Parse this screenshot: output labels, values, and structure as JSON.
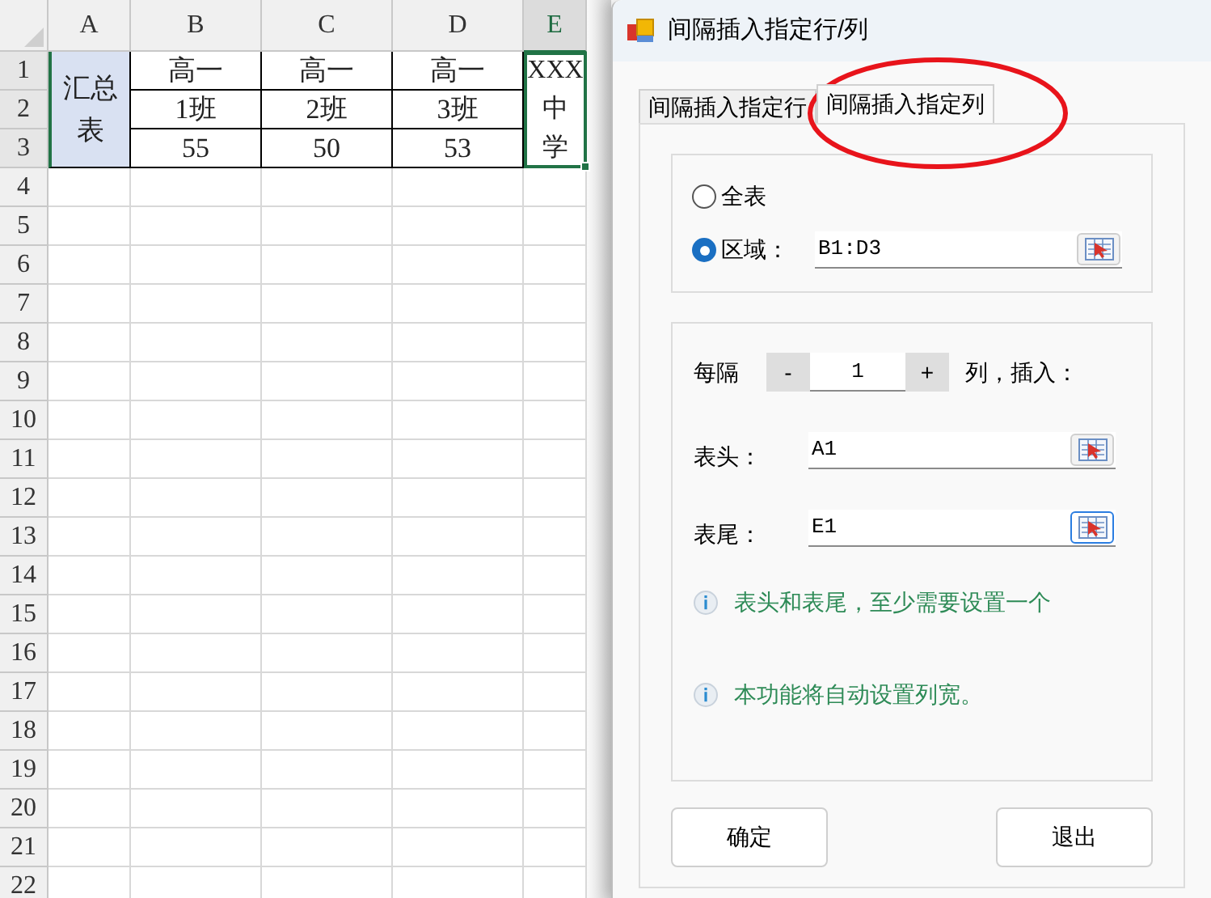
{
  "sheet": {
    "columns": [
      {
        "label": "A",
        "selected": false
      },
      {
        "label": "B",
        "selected": false
      },
      {
        "label": "C",
        "selected": false
      },
      {
        "label": "D",
        "selected": false
      },
      {
        "label": "E",
        "selected": true
      }
    ],
    "rows": [
      "1",
      "2",
      "3",
      "4",
      "5",
      "6",
      "7",
      "8",
      "9",
      "10",
      "11",
      "12",
      "13",
      "14",
      "15",
      "16",
      "17",
      "18",
      "19",
      "20",
      "21",
      "22"
    ],
    "summary_cell": {
      "lines": [
        "汇总",
        "表"
      ]
    },
    "table_rows": [
      [
        "高一",
        "高一",
        "高一"
      ],
      [
        "1班",
        "2班",
        "3班"
      ],
      [
        "55",
        "50",
        "53"
      ]
    ],
    "school_cell": {
      "lines": [
        "XXX",
        "中",
        "学"
      ],
      "selected": true
    }
  },
  "dialog": {
    "title": "间隔插入指定行/列",
    "tabs": [
      {
        "label": "间隔插入指定行",
        "selected": false
      },
      {
        "label": "间隔插入指定列",
        "selected": true
      }
    ],
    "scope": [
      {
        "label": "全表",
        "selected": false
      },
      {
        "label": "区域：",
        "selected": true,
        "value": "B1:D3"
      }
    ],
    "every_label": "每隔",
    "step": {
      "minus": "-",
      "value": "1",
      "plus": "+"
    },
    "every_suffix": "列，插入：",
    "header": {
      "label": "表头：",
      "value": "A1",
      "focused": false
    },
    "footer": {
      "label": "表尾：",
      "value": "E1",
      "focused": true
    },
    "notes": [
      "表头和表尾，至少需要设置一个",
      "本功能将自动设置列宽。"
    ],
    "buttons": [
      "确定",
      "退出"
    ]
  }
}
